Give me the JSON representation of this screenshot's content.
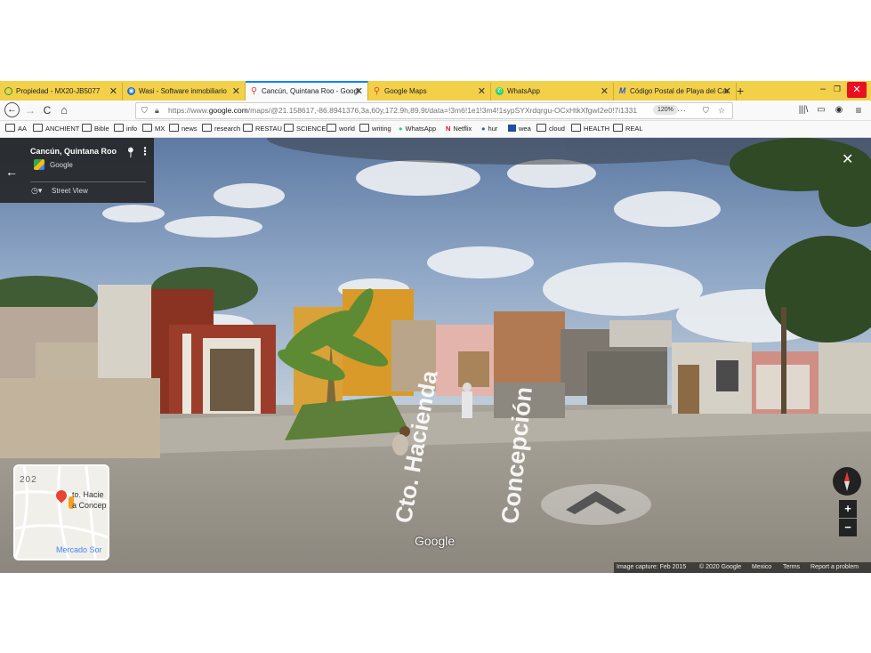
{
  "tabs": [
    {
      "title": "Propiedad - MX20-JB5077",
      "icon": "globe-icon",
      "color": "#1a9e3f"
    },
    {
      "title": "Wasi - Software inmobiliario",
      "icon": "wasi-icon",
      "color": "#1f6fd6"
    },
    {
      "title": "Cancún, Quintana Roo - Googl",
      "icon": "maps-pin-icon",
      "color": "#ea4335"
    },
    {
      "title": "Google Maps",
      "icon": "maps-pin-icon",
      "color": "#ea4335"
    },
    {
      "title": "WhatsApp",
      "icon": "whatsapp-icon",
      "color": "#25d366"
    },
    {
      "title": "Código Postal de Playa del Car",
      "icon": "m-icon",
      "color": "#2e5bc9"
    }
  ],
  "tabbar": {
    "new_tab": "+",
    "minimize": "–",
    "maximize": "❐",
    "close": "✕"
  },
  "nav": {
    "back": "←",
    "forward": "→",
    "reload": "C",
    "home": "⌂",
    "url_prefix": "https://www.",
    "url_domain": "google.com",
    "url_rest": "/maps/@21.158617,-86.8941376,3a,60y,172.9h,89.9t/data=!3m6!1e1!3m4!1sypSYXrdqrgu-OCxHtkXfgwI2e0!7i1331",
    "zoom": "120%",
    "more": "···"
  },
  "bookmarks": [
    {
      "label": "AA",
      "type": "folder"
    },
    {
      "label": "ANCHIENT",
      "type": "folder"
    },
    {
      "label": "Bible",
      "type": "folder"
    },
    {
      "label": "info",
      "type": "folder"
    },
    {
      "label": "MX",
      "type": "folder"
    },
    {
      "label": "news",
      "type": "folder"
    },
    {
      "label": "research",
      "type": "folder"
    },
    {
      "label": "RESTAU",
      "type": "folder"
    },
    {
      "label": "SCIENCE",
      "type": "folder"
    },
    {
      "label": "world",
      "type": "folder"
    },
    {
      "label": "writing",
      "type": "folder"
    },
    {
      "label": "WhatsApp",
      "type": "whatsapp"
    },
    {
      "label": "Netflix",
      "type": "netflix"
    },
    {
      "label": "hur",
      "type": "site"
    },
    {
      "label": "wea",
      "type": "site"
    },
    {
      "label": "cloud",
      "type": "folder"
    },
    {
      "label": "HEALTH",
      "type": "folder"
    },
    {
      "label": "REAL",
      "type": "folder"
    }
  ],
  "streetview": {
    "place_title": "Cancún, Quintana Roo",
    "provider": "Google",
    "mode": "Street View",
    "back_arrow": "←",
    "close": "✕",
    "street_label_1": "Cto. Hacienda",
    "street_label_2": "Concepción",
    "google_watermark": "Google",
    "minimap": {
      "number": "202",
      "label_1": "to. Hacie",
      "label_2": "a Concep",
      "label_3": "Mercado Sor"
    },
    "attribution": [
      "Image capture: Feb 2015",
      "© 2020 Google",
      "Mexico",
      "Terms",
      "Report a problem"
    ],
    "zoom_in": "+",
    "zoom_out": "−"
  }
}
